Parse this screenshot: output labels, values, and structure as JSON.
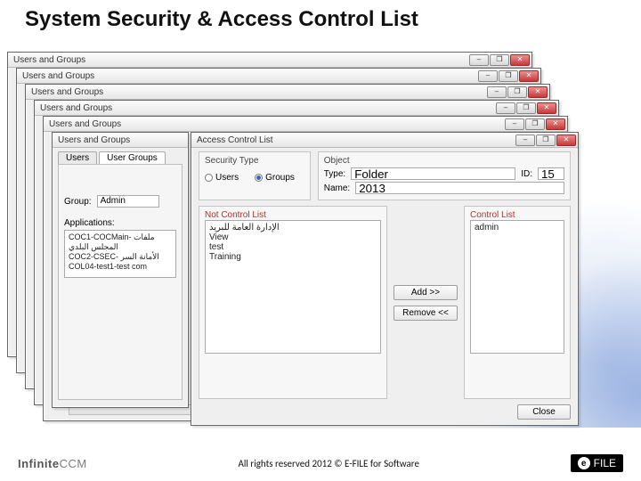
{
  "slide": {
    "title": "System Security & Access Control List",
    "copyright": "All rights reserved 2012 © E-FILE for Software",
    "brand_left_prefix": "Infinite",
    "brand_left_suffix": "CCM",
    "efile_text": "FILE"
  },
  "stacked_window_title": "Users and Groups",
  "win_controls": {
    "min": "–",
    "max": "❐",
    "close": "✕"
  },
  "ug_window": {
    "tabs": {
      "users": "Users",
      "user_groups": "User Groups"
    },
    "group_label": "Group:",
    "group_value": "Admin",
    "applications_label": "Applications:",
    "apps": [
      "COC1-COCMain- ملفات المجلس البلدي",
      "COC2-CSEC- الأمانة السر",
      "COL04-test1-test com"
    ]
  },
  "acl_window": {
    "title": "Access Control List",
    "sections": {
      "security_type": "Security Type",
      "object": "Object"
    },
    "radios": {
      "users": "Users",
      "groups": "Groups"
    },
    "object_fields": {
      "type_label": "Type:",
      "type_value": "Folder",
      "id_label": "ID:",
      "id_value": "15",
      "name_label": "Name:",
      "name_value": "2013"
    },
    "list_headers": {
      "not_control": "Not Control List",
      "control": "Control List"
    },
    "not_control_items": [
      "الإدارة العامة للبريد",
      "View",
      "test",
      "Training"
    ],
    "control_items": [
      "admin"
    ],
    "buttons": {
      "add": "Add >>",
      "remove": "Remove <<",
      "close": "Close"
    }
  }
}
